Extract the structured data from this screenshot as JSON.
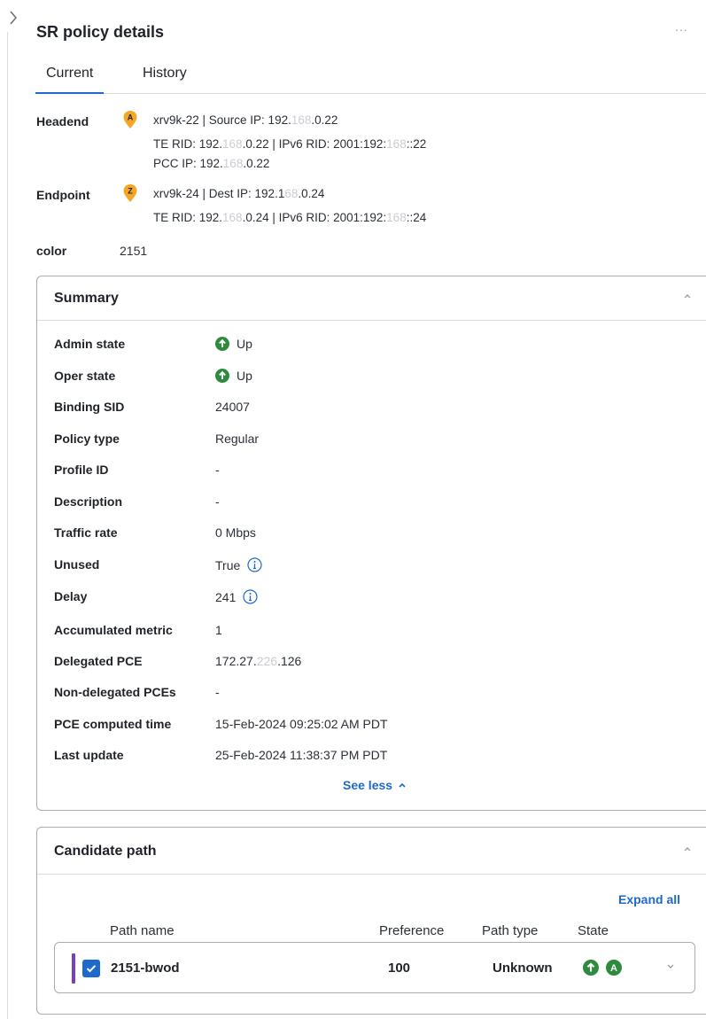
{
  "panel": {
    "title": "SR policy details",
    "more_menu": "...",
    "tabs": [
      {
        "label": "Current",
        "active": true
      },
      {
        "label": "History",
        "active": false
      }
    ]
  },
  "headend": {
    "label": "Headend",
    "pin_letter": "A",
    "line1_a": "xrv9k-22 | Source IP: 192.",
    "line1_blur": "168",
    "line1_b": ".0.22",
    "line2_a": "TE RID: 192.",
    "line2_blur1": "168",
    "line2_b": ".0.22 | IPv6 RID: 2001:192:",
    "line2_blur2": "168",
    "line2_c": "::22",
    "line3_a": "PCC IP: 192.",
    "line3_blur": "168",
    "line3_b": ".0.22"
  },
  "endpoint": {
    "label": "Endpoint",
    "pin_letter": "Z",
    "line1_a": "xrv9k-24 | Dest IP: 192.1",
    "line1_blur": "68",
    "line1_b": ".0.24",
    "line2_a": "TE RID: 192.",
    "line2_blur1": "168",
    "line2_b": ".0.24 | IPv6 RID: 2001:192:",
    "line2_blur2": "168",
    "line2_c": "::24"
  },
  "color": {
    "label": "color",
    "value": "2151"
  },
  "summary": {
    "title": "Summary",
    "rows": [
      {
        "label": "Admin state",
        "value": "Up"
      },
      {
        "label": "Oper state",
        "value": "Up"
      },
      {
        "label": "Binding SID",
        "value": "24007"
      },
      {
        "label": "Policy type",
        "value": "Regular"
      },
      {
        "label": "Profile ID",
        "value": "-"
      },
      {
        "label": "Description",
        "value": "-"
      },
      {
        "label": "Traffic rate",
        "value": "0 Mbps"
      },
      {
        "label": "Unused",
        "value": "True"
      },
      {
        "label": "Delay",
        "value": "241"
      },
      {
        "label": "Accumulated metric",
        "value": "1"
      },
      {
        "label": "Delegated PCE",
        "value_a": "172.27.",
        "value_blur": "226",
        "value_b": ".126"
      },
      {
        "label": "Non-delegated PCEs",
        "value": "-"
      },
      {
        "label": "PCE computed time",
        "value": "15-Feb-2024 09:25:02 AM PDT"
      },
      {
        "label": "Last update",
        "value": "25-Feb-2024 11:38:37 PM PDT"
      }
    ],
    "see_less": "See less"
  },
  "candidate": {
    "title": "Candidate path",
    "expand_all": "Expand all",
    "columns": {
      "name": "Path name",
      "preference": "Preference",
      "type": "Path type",
      "state": "State"
    },
    "paths": [
      {
        "name": "2151-bwod",
        "preference": "100",
        "type": "Unknown",
        "state_badge": "A",
        "selected": true
      }
    ]
  },
  "colors": {
    "accent": "#1d69cc",
    "pin": "#f5a623",
    "up_green": "#2e8b3e",
    "path_accent": "#7a3fbf"
  }
}
